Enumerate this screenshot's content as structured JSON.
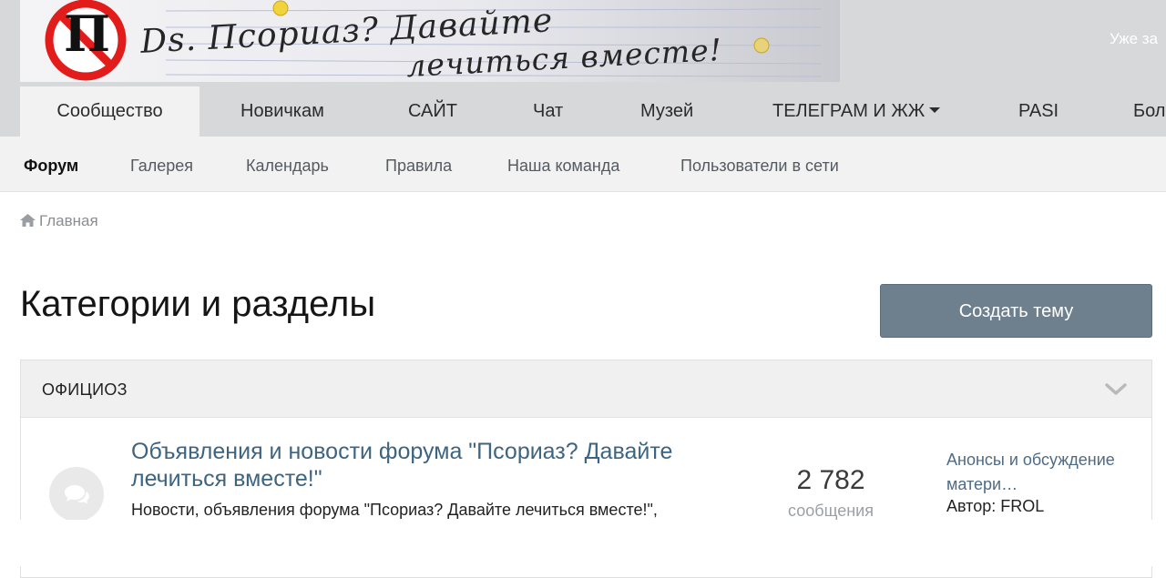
{
  "banner": {
    "headline_line1": "Ds. Псориаз? Давайте",
    "headline_line2": "лечиться вместе!",
    "logo_letter": "П"
  },
  "header": {
    "user_text": "Уже за"
  },
  "primary_nav": [
    {
      "label": "Сообщество",
      "active": true
    },
    {
      "label": "Новичкам"
    },
    {
      "label": "САЙТ"
    },
    {
      "label": "Чат"
    },
    {
      "label": "Музей"
    },
    {
      "label": "ТЕЛЕГРАМ И ЖЖ",
      "has_dropdown": true
    },
    {
      "label": "PASI"
    },
    {
      "label": "Бол"
    }
  ],
  "secondary_nav": [
    {
      "label": "Форум",
      "active": true
    },
    {
      "label": "Галерея"
    },
    {
      "label": "Календарь"
    },
    {
      "label": "Правила"
    },
    {
      "label": "Наша команда"
    },
    {
      "label": "Пользователи в сети"
    }
  ],
  "breadcrumb": {
    "home_label": "Главная",
    "icon": "home-icon"
  },
  "page": {
    "title": "Категории и разделы",
    "create_button": "Создать тему",
    "accent_color": "#6e7f8d"
  },
  "category": {
    "title": "ОФИЦИОЗ",
    "forums": [
      {
        "title": "Объявления и новости форума \"Псориаз? Давайте лечиться вместе!\"",
        "description": "Новости, объявления форума \"Псориаз? Давайте лечиться вместе!\",",
        "post_count": "2 782",
        "post_label": "сообщения",
        "last_post_title": "Анонсы и обсуждение матери…",
        "last_post_author": "Автор: FROL",
        "link_color": "#3d6480"
      }
    ]
  }
}
